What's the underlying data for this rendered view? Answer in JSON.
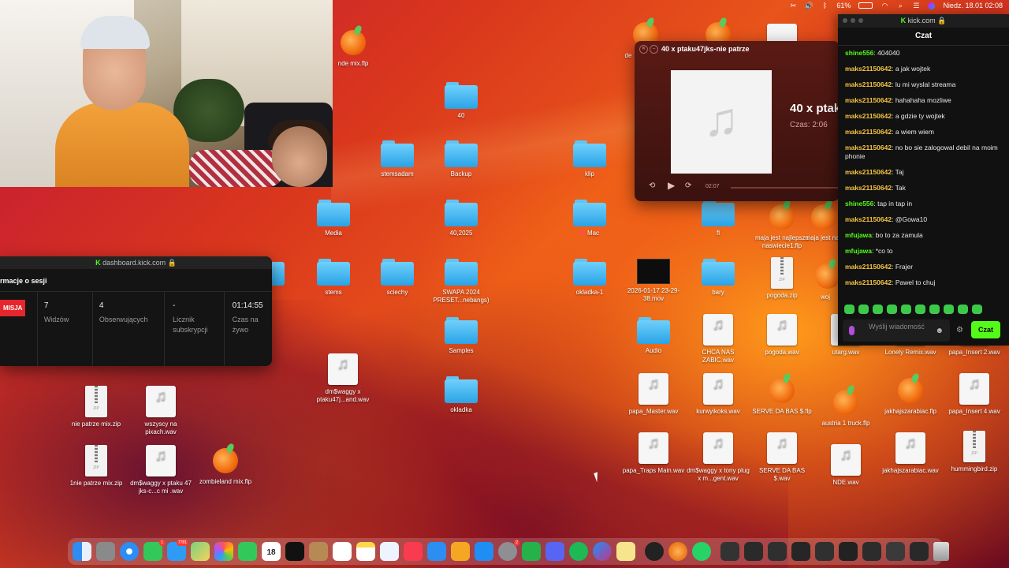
{
  "menubar": {
    "battery": "61%",
    "datetime": "Niedz. 18.01  02:08"
  },
  "desktop_icons": [
    {
      "name": "nde mix.flp",
      "type": "flp",
      "x": "425",
      "y": "30"
    },
    {
      "name": "40",
      "type": "folder"
    },
    {
      "name": "stemsadam",
      "type": "folder"
    },
    {
      "name": "Backup",
      "type": "folder"
    },
    {
      "name": "klip",
      "type": "folder"
    },
    {
      "name": "Media",
      "type": "folder"
    },
    {
      "name": "40,2025",
      "type": "folder"
    },
    {
      "name": "Mac",
      "type": "folder"
    },
    {
      "name": "fl",
      "type": "folder"
    },
    {
      "name": "maja jest najlepsza naswiecie1.flp",
      "type": "flp"
    },
    {
      "name": "maja jest nas",
      "type": "flp"
    },
    {
      "name": "s 1",
      "type": "folder"
    },
    {
      "name": "stems",
      "type": "folder"
    },
    {
      "name": "sciechy",
      "type": "folder"
    },
    {
      "name": "SWAPA 2024 PRESET...nebangs)",
      "type": "folder"
    },
    {
      "name": "okladka-1",
      "type": "folder"
    },
    {
      "name": "2026-01-17 23-29-38.mov",
      "type": "video"
    },
    {
      "name": "bary",
      "type": "folder"
    },
    {
      "name": "pogoda.zip",
      "type": "zip"
    },
    {
      "name": "woj",
      "type": "flp"
    },
    {
      "name": "Samples",
      "type": "folder"
    },
    {
      "name": "Audio",
      "type": "folder"
    },
    {
      "name": "CHCA NAS ZABIC.wav",
      "type": "wav"
    },
    {
      "name": "pogoda.wav",
      "type": "wav"
    },
    {
      "name": "utarg.wav",
      "type": "wav"
    },
    {
      "name": "Lonely Remix.wav",
      "type": "wav"
    },
    {
      "name": "papa_Insert 2.wav",
      "type": "wav"
    },
    {
      "name": "dm$waggy x ptaku47j...and.wav",
      "type": "wav"
    },
    {
      "name": "okladka",
      "type": "folder"
    },
    {
      "name": "papa_Master.wav",
      "type": "wav"
    },
    {
      "name": "kurwyikoks.wav",
      "type": "wav"
    },
    {
      "name": "SERVE DA BAS $.flp",
      "type": "flp"
    },
    {
      "name": "austria 1 truck.flp",
      "type": "flp"
    },
    {
      "name": "jakhajszarabiac.flp",
      "type": "flp"
    },
    {
      "name": "papa_Insert 4.wav",
      "type": "wav"
    },
    {
      "name": "nie patrze mix.zip",
      "type": "zip"
    },
    {
      "name": "wszyscy na pixach.wav",
      "type": "wav"
    },
    {
      "name": "1nie patrze mix.zip",
      "type": "zip"
    },
    {
      "name": "dm$waggy x ptaku 47 jks-c...c mi .wav",
      "type": "wav"
    },
    {
      "name": "zombieland mix.flp",
      "type": "flp"
    },
    {
      "name": "papa_Traps Main.wav",
      "type": "wav"
    },
    {
      "name": "dm$waggy x tony plug x m...gent.wav",
      "type": "wav"
    },
    {
      "name": "SERVE DA BAS $.wav",
      "type": "wav"
    },
    {
      "name": "NDE.wav",
      "type": "wav"
    },
    {
      "name": "jakhajszarabiac.wav",
      "type": "wav"
    },
    {
      "name": "hummingbird.zip",
      "type": "zip"
    },
    {
      "name": "de",
      "type": "flp"
    }
  ],
  "dashboard": {
    "url": "dashboard.kick.com",
    "section": "rmacje o sesji",
    "live_badge": "MISJA",
    "stats": [
      {
        "value": "7",
        "label": "Widzów"
      },
      {
        "value": "4",
        "label": "Obserwujących"
      },
      {
        "value": "-",
        "label": "Licznik subskrypcji"
      },
      {
        "value": "01:14:55",
        "label": "Czas na żywo"
      }
    ]
  },
  "player": {
    "title": "40 x ptaku47jks-nie patrze",
    "big_title": "40 x ptak",
    "duration": "Czas: 2:06",
    "elapsed": "02:07"
  },
  "chat": {
    "url": "kick.com",
    "header": "Czat",
    "messages": [
      {
        "user": "shine556",
        "text": "404040",
        "color": "#53fc18"
      },
      {
        "user": "maks21150642",
        "text": "a jak wojtek",
        "color": "#f5c542"
      },
      {
        "user": "maks21150642",
        "text": "lu mi wyslal streama",
        "color": "#f5c542"
      },
      {
        "user": "maks21150642",
        "text": "hahahaha mozliwe",
        "color": "#f5c542"
      },
      {
        "user": "maks21150642",
        "text": "a gdzie ty wojtek",
        "color": "#f5c542"
      },
      {
        "user": "maks21150642",
        "text": "a wiem wiem",
        "color": "#f5c542"
      },
      {
        "user": "maks21150642",
        "text": "no bo sie zalogowal debil na moim phonie",
        "color": "#f5c542"
      },
      {
        "user": "maks21150642",
        "text": "Taj",
        "color": "#f5c542"
      },
      {
        "user": "maks21150642",
        "text": "Tak",
        "color": "#f5c542"
      },
      {
        "user": "shine556",
        "text": "tap in tap in",
        "color": "#53fc18"
      },
      {
        "user": "maks21150642",
        "text": "@Gowa10",
        "color": "#f5c542"
      },
      {
        "user": "mfujawa",
        "text": "bo to za zamula",
        "color": "#53fc18"
      },
      {
        "user": "mfujawa",
        "text": "*co to",
        "color": "#53fc18"
      },
      {
        "user": "maks21150642",
        "text": "Frajer",
        "color": "#f5c542"
      },
      {
        "user": "maks21150642",
        "text": "Pawel to chuj",
        "color": "#f5c542"
      }
    ],
    "input_placeholder": "Wyślij wiadomość",
    "send_label": "Czat"
  },
  "dock": {
    "calendar_day": "18",
    "mail_badge": "7781",
    "messages_badge": "1",
    "settings_badge": "2"
  },
  "colors": {
    "kick_green": "#53fc18",
    "live_red": "#e5262c",
    "username_yellow": "#f5c542"
  }
}
